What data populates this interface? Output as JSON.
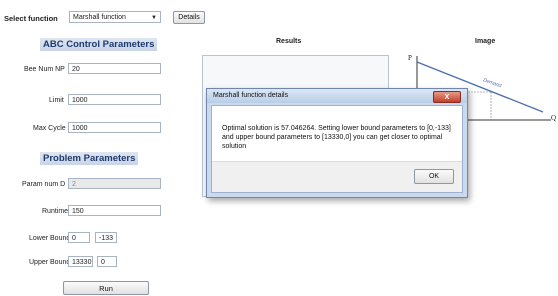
{
  "header": {
    "select_label": "Select function",
    "function_value": "Marshall function",
    "details_label": "Details"
  },
  "abc": {
    "title": "ABC Control Parameters",
    "bee_label": "Bee Num NP",
    "bee_value": "20",
    "limit_label": "Limit",
    "limit_value": "1000",
    "maxcycle_label": "Max Cycle",
    "maxcycle_value": "1000"
  },
  "problem": {
    "title": "Problem Parameters",
    "paramnum_label": "Param num D",
    "paramnum_value": "2",
    "runtime_label": "Runtime",
    "runtime_value": "150",
    "lower_label": "Lower Bound",
    "lower_values": [
      "0",
      "-133"
    ],
    "upper_label": "Upper Bound",
    "upper_values": [
      "13330",
      "0"
    ]
  },
  "run_label": "Run",
  "results": {
    "title": "Results"
  },
  "image": {
    "title": "Image",
    "axis_p": "P",
    "axis_q": "Q",
    "curve_label": "Demand"
  },
  "dialog": {
    "title": "Marshall function details",
    "close_label": "X",
    "message": "Optimal solution is 57.046264. Setting lower bound parameters to [0,-133] and upper bound parameters to [13330,0] you can get closer to optimal solution",
    "ok_label": "OK"
  },
  "colors": {
    "section_title": "#1e3a6e",
    "dialog_frame": "#c9daf0",
    "close_button": "#c2402b",
    "demand_line": "#4a6fb0"
  }
}
